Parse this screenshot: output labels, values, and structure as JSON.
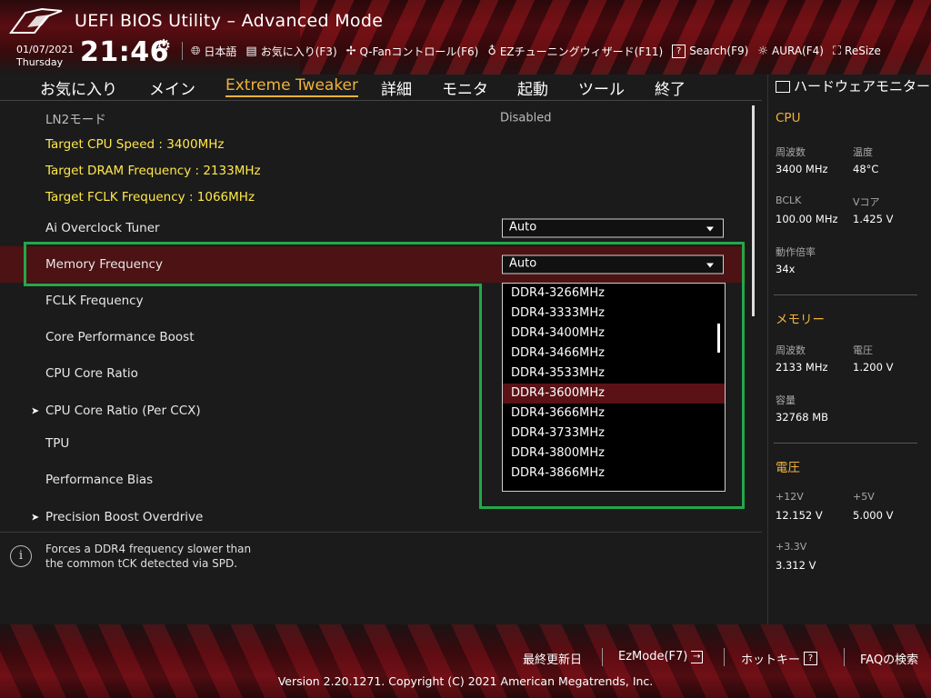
{
  "header": {
    "title": "UEFI BIOS Utility – Advanced Mode",
    "date": "01/07/2021",
    "weekday": "Thursday",
    "time": "21:46",
    "toolbar": [
      {
        "icon": "globe-icon",
        "label": "日本語"
      },
      {
        "icon": "favorites-icon",
        "label": "お気に入り(F3)"
      },
      {
        "icon": "fan-icon",
        "label": "Q-Fanコントロール(F6)"
      },
      {
        "icon": "bulb-icon",
        "label": "EZチューニングウィザード(F11)"
      },
      {
        "icon": "help-box-icon",
        "label": "Search(F9)"
      },
      {
        "icon": "aura-icon",
        "label": "AURA(F4)"
      },
      {
        "icon": "resize-icon",
        "label": "ReSize"
      }
    ]
  },
  "tabs": [
    "お気に入り",
    "メイン",
    "Extreme Tweaker",
    "詳細",
    "モニタ",
    "起動",
    "ツール",
    "終了"
  ],
  "active_tab": "Extreme Tweaker",
  "settings": {
    "ln2": {
      "label": "LN2モード",
      "value": "Disabled"
    },
    "target_cpu": "Target CPU Speed : 3400MHz",
    "target_dram": "Target DRAM Frequency : 2133MHz",
    "target_fclk": "Target FCLK Frequency : 1066MHz",
    "ai_tuner": {
      "label": "Ai Overclock Tuner",
      "value": "Auto"
    },
    "mem_freq": {
      "label": "Memory Frequency",
      "value": "Auto"
    },
    "fclk": "FCLK Frequency",
    "cpb": "Core Performance Boost",
    "ccr": "CPU Core Ratio",
    "ccr_ccx": "CPU Core Ratio (Per CCX)",
    "tpu": "TPU",
    "perf_bias": "Performance Bias",
    "pbo": "Precision Boost Overdrive"
  },
  "dropdown": {
    "options": [
      "DDR4-3266MHz",
      "DDR4-3333MHz",
      "DDR4-3400MHz",
      "DDR4-3466MHz",
      "DDR4-3533MHz",
      "DDR4-3600MHz",
      "DDR4-3666MHz",
      "DDR4-3733MHz",
      "DDR4-3800MHz",
      "DDR4-3866MHz"
    ],
    "highlighted": "DDR4-3600MHz"
  },
  "help": {
    "line1": "Forces a DDR4 frequency slower than",
    "line2": "the common tCK detected via SPD."
  },
  "sidebar": {
    "title": "ハードウェアモニター",
    "cpu": {
      "section": "CPU",
      "freq_label": "周波数",
      "freq": "3400 MHz",
      "temp_label": "温度",
      "temp": "48°C",
      "bclk_label": "BCLK",
      "bclk": "100.00 MHz",
      "vcore_label": "Vコア",
      "vcore": "1.425 V",
      "ratio_label": "動作倍率",
      "ratio": "34x"
    },
    "memory": {
      "section": "メモリー",
      "freq_label": "周波数",
      "freq": "2133 MHz",
      "volt_label": "電圧",
      "volt": "1.200 V",
      "cap_label": "容量",
      "cap": "32768 MB"
    },
    "voltage": {
      "section": "電圧",
      "v12_label": "+12V",
      "v12": "12.152 V",
      "v5_label": "+5V",
      "v5": "5.000 V",
      "v33_label": "+3.3V",
      "v33": "3.312 V"
    }
  },
  "footer": {
    "last_modified": "最終更新日",
    "ezmode": "EzMode(F7)",
    "hotkeys": "ホットキー",
    "faq": "FAQの検索",
    "copyright": "Version 2.20.1271. Copyright (C) 2021 American Megatrends, Inc."
  },
  "colors": {
    "accent": "#f0b23c",
    "selected_row": "#4c1214",
    "target_text": "#ffe84a",
    "highlight_box": "#22a84a"
  }
}
